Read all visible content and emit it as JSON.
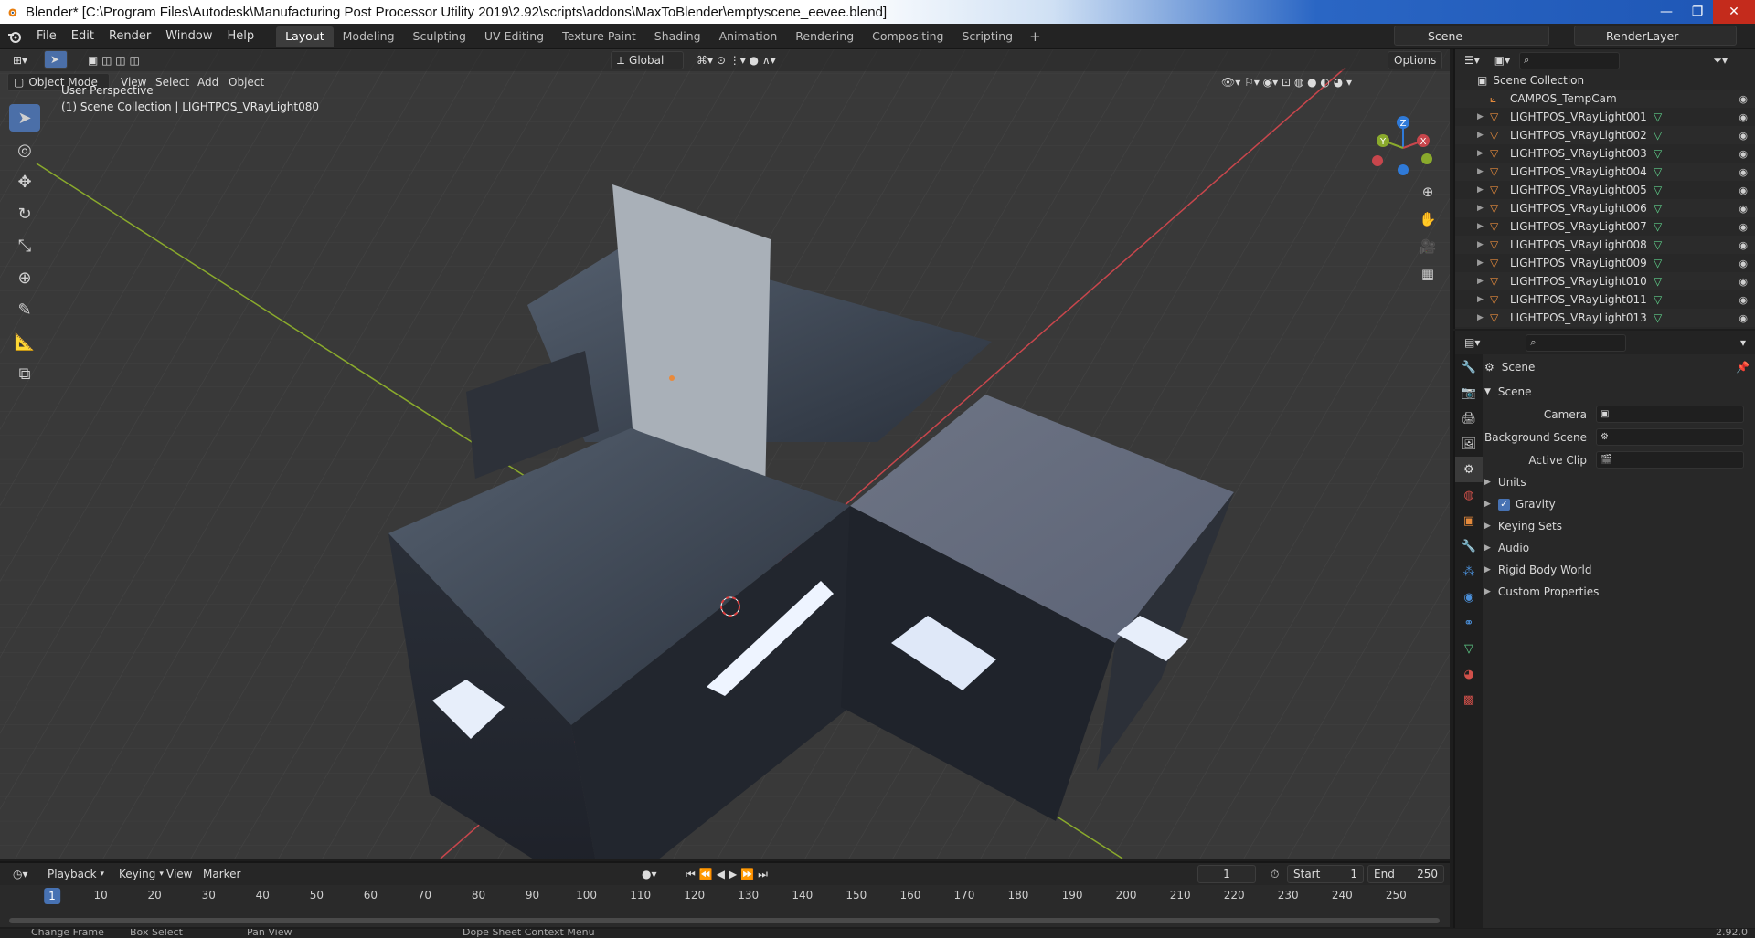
{
  "window": {
    "title": "Blender* [C:\\Program Files\\Autodesk\\Manufacturing Post Processor Utility 2019\\2.92\\scripts\\addons\\MaxToBlender\\emptyscene_eevee.blend]",
    "controls": {
      "minimize": "—",
      "maximize": "❐",
      "close": "✕"
    }
  },
  "menubar": {
    "items": [
      "File",
      "Edit",
      "Render",
      "Window",
      "Help"
    ],
    "workspaces": [
      "Layout",
      "Modeling",
      "Sculpting",
      "UV Editing",
      "Texture Paint",
      "Shading",
      "Animation",
      "Rendering",
      "Compositing",
      "Scripting"
    ],
    "active_workspace": "Layout",
    "add_tab": "+",
    "scene": "Scene",
    "render_layer": "RenderLayer"
  },
  "viewport": {
    "mode": "Object Mode",
    "menus": [
      "View",
      "Select",
      "Add",
      "Object"
    ],
    "transform_orientation": "Global",
    "options": "Options",
    "info_line1": "User Perspective",
    "info_line2": "(1) Scene Collection | LIGHTPOS_VRayLight080",
    "gizmo": {
      "x": "X",
      "y": "Y",
      "z": "Z"
    },
    "colors": {
      "background": "#393939",
      "grid": "#444444",
      "x_axis": "#c8464c",
      "y_axis": "#8aaa2c"
    }
  },
  "outliner": {
    "root": "Scene Collection",
    "items": [
      {
        "label": "CAMPOS_TempCam",
        "type": "camera"
      },
      {
        "label": "LIGHTPOS_VRayLight001",
        "type": "light"
      },
      {
        "label": "LIGHTPOS_VRayLight002",
        "type": "light"
      },
      {
        "label": "LIGHTPOS_VRayLight003",
        "type": "light"
      },
      {
        "label": "LIGHTPOS_VRayLight004",
        "type": "light"
      },
      {
        "label": "LIGHTPOS_VRayLight005",
        "type": "light"
      },
      {
        "label": "LIGHTPOS_VRayLight006",
        "type": "light"
      },
      {
        "label": "LIGHTPOS_VRayLight007",
        "type": "light"
      },
      {
        "label": "LIGHTPOS_VRayLight008",
        "type": "light"
      },
      {
        "label": "LIGHTPOS_VRayLight009",
        "type": "light"
      },
      {
        "label": "LIGHTPOS_VRayLight010",
        "type": "light"
      },
      {
        "label": "LIGHTPOS_VRayLight011",
        "type": "light"
      },
      {
        "label": "LIGHTPOS_VRayLight013",
        "type": "light"
      }
    ]
  },
  "properties": {
    "context": "Scene",
    "panel": "Scene",
    "fields": [
      {
        "label": "Camera"
      },
      {
        "label": "Background Scene"
      },
      {
        "label": "Active Clip"
      }
    ],
    "subpanels": [
      {
        "label": "Units",
        "checkbox": false
      },
      {
        "label": "Gravity",
        "checkbox": true
      },
      {
        "label": "Keying Sets",
        "checkbox": false
      },
      {
        "label": "Audio",
        "checkbox": false
      },
      {
        "label": "Rigid Body World",
        "checkbox": false
      },
      {
        "label": "Custom Properties",
        "checkbox": false
      }
    ]
  },
  "timeline": {
    "menus": [
      "Playback",
      "Keying",
      "View",
      "Marker"
    ],
    "current_frame": "1",
    "start_label": "Start",
    "start": "1",
    "end_label": "End",
    "end": "250",
    "ruler": [
      "1",
      "10",
      "20",
      "30",
      "40",
      "50",
      "60",
      "70",
      "80",
      "90",
      "100",
      "110",
      "120",
      "130",
      "140",
      "150",
      "160",
      "170",
      "180",
      "190",
      "200",
      "210",
      "220",
      "230",
      "240",
      "250"
    ]
  },
  "statusbar": {
    "items": [
      "Change Frame",
      "Box Select",
      "Pan View",
      "Dope Sheet Context Menu"
    ],
    "version": "2.92.0"
  }
}
